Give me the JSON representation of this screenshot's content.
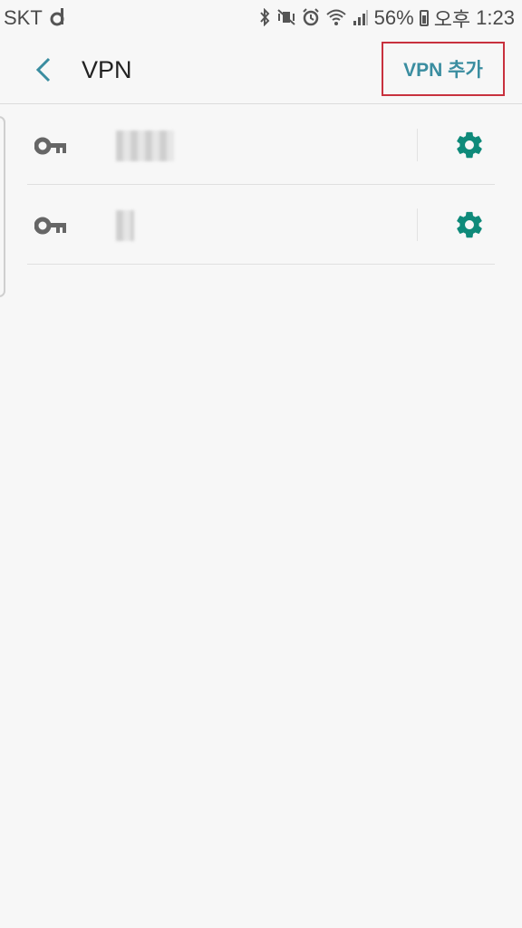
{
  "status_bar": {
    "carrier": "SKT",
    "battery": "56%",
    "ampm": "오후",
    "time": "1:23"
  },
  "header": {
    "back_icon": "chevron-left-icon",
    "title": "VPN",
    "add_button_label": "VPN 추가"
  },
  "vpn_list": [
    {
      "name": "▮▮▮▮",
      "key_icon": "key-icon",
      "settings_icon": "gear-icon"
    },
    {
      "name": "▮",
      "key_icon": "key-icon",
      "settings_icon": "gear-icon"
    }
  ],
  "colors": {
    "accent": "#3a8da0",
    "gear": "#0f8a7a",
    "highlight_border": "#c8313e",
    "background": "#f7f7f7"
  }
}
